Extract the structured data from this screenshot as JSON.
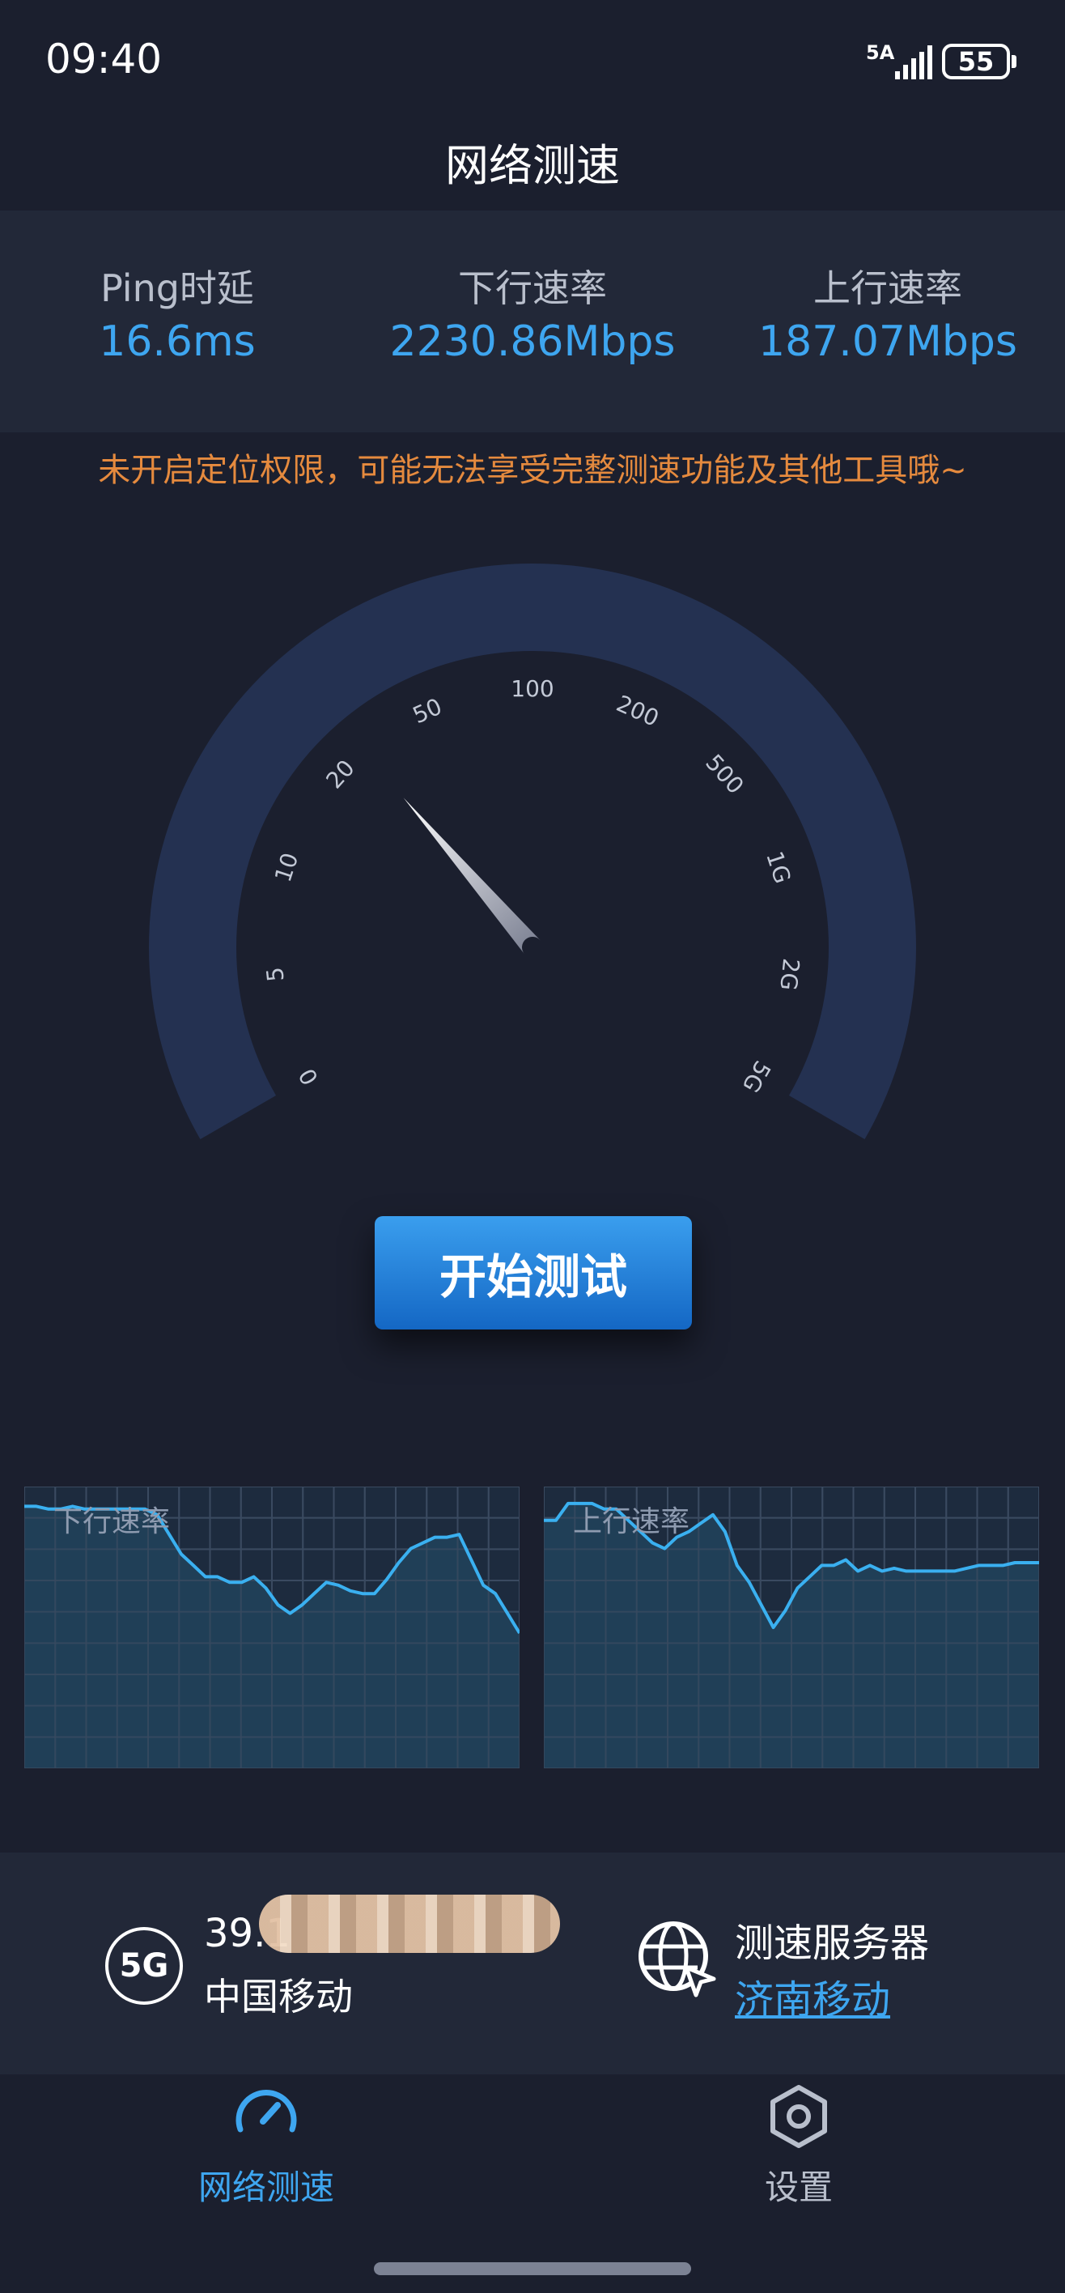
{
  "status_bar": {
    "time": "09:40",
    "network_type": "5A",
    "battery": "55"
  },
  "header": {
    "title": "网络测速"
  },
  "metrics": [
    {
      "label": "Ping时延",
      "value": "16.6ms"
    },
    {
      "label": "下行速率",
      "value": "2230.86Mbps"
    },
    {
      "label": "上行速率",
      "value": "187.07Mbps"
    }
  ],
  "warning": "未开启定位权限，可能无法享受完整测速功能及其他工具哦~",
  "gauge": {
    "ticks": [
      "0",
      "5",
      "10",
      "20",
      "50",
      "100",
      "200",
      "500",
      "1G",
      "2G",
      "5G"
    ],
    "needle_fraction": 0.33
  },
  "start_button": {
    "label": "开始测试"
  },
  "charts": {
    "download": {
      "label": "下行速率",
      "points": [
        0.93,
        0.93,
        0.92,
        0.92,
        0.93,
        0.92,
        0.92,
        0.92,
        0.92,
        0.92,
        0.92,
        0.9,
        0.83,
        0.76,
        0.72,
        0.68,
        0.68,
        0.66,
        0.66,
        0.68,
        0.64,
        0.58,
        0.55,
        0.58,
        0.62,
        0.66,
        0.65,
        0.63,
        0.62,
        0.62,
        0.67,
        0.73,
        0.78,
        0.8,
        0.82,
        0.82,
        0.83,
        0.74,
        0.65,
        0.62,
        0.55,
        0.48
      ]
    },
    "upload": {
      "label": "上行速率",
      "points": [
        0.88,
        0.88,
        0.94,
        0.94,
        0.94,
        0.92,
        0.92,
        0.88,
        0.84,
        0.8,
        0.78,
        0.82,
        0.84,
        0.87,
        0.9,
        0.84,
        0.72,
        0.66,
        0.58,
        0.5,
        0.56,
        0.64,
        0.68,
        0.72,
        0.72,
        0.74,
        0.7,
        0.72,
        0.7,
        0.71,
        0.7,
        0.7,
        0.7,
        0.7,
        0.7,
        0.71,
        0.72,
        0.72,
        0.72,
        0.73,
        0.73,
        0.73
      ]
    },
    "grid_color": "#3a4a60",
    "line_color": "#3ab0f0",
    "fill_color": "#21435c"
  },
  "network": {
    "badge": "5G",
    "ip": "39.1",
    "carrier": "中国移动",
    "server_label": "测速服务器",
    "server_name": "济南移动"
  },
  "bottom_nav": [
    {
      "label": "网络测速",
      "icon": "speedometer-icon",
      "active": true
    },
    {
      "label": "设置",
      "icon": "hexagon-settings-icon",
      "active": false
    }
  ],
  "colors": {
    "background": "#1b1f2e",
    "panel": "#222838",
    "accent": "#3ea6f0",
    "warning": "#e58a3e",
    "inactive": "#b9bfcc"
  }
}
